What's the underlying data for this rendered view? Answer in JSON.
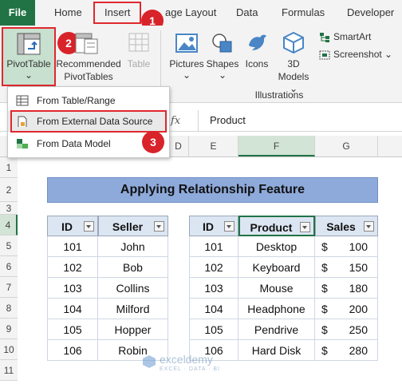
{
  "ribbon_tabs": [
    "File",
    "Home",
    "Insert",
    "age Layout",
    "Data",
    "Formulas",
    "Developer"
  ],
  "pivot": {
    "label": "PivotTable",
    "chevron": "⌄"
  },
  "recommended": {
    "label1": "Recommended",
    "label2": "PivotTables"
  },
  "table_btn": "Table",
  "illustrations": {
    "pictures": "Pictures",
    "shapes": "Shapes",
    "icons": "Icons",
    "models_3d_1": "3D",
    "models_3d_2": "Models",
    "smartart": "SmartArt",
    "screenshot": "Screenshot",
    "group_label": "Illustrations"
  },
  "dropdown": {
    "items": [
      "From Table/Range",
      "From External Data Source",
      "From Data Model"
    ]
  },
  "badges": [
    "1",
    "2",
    "3"
  ],
  "formula": {
    "fx": "fx",
    "value": "Product"
  },
  "columns": [
    "D",
    "E",
    "F",
    "G"
  ],
  "rows": [
    "1",
    "2",
    "3",
    "4",
    "5",
    "6",
    "7",
    "8",
    "9",
    "10",
    "11"
  ],
  "title": "Applying Relationship Feature",
  "table1": {
    "headers": [
      "ID",
      "Seller"
    ],
    "rows": [
      [
        "101",
        "John"
      ],
      [
        "102",
        "Bob"
      ],
      [
        "103",
        "Collins"
      ],
      [
        "104",
        "Milford"
      ],
      [
        "105",
        "Hopper"
      ],
      [
        "106",
        "Robin"
      ]
    ]
  },
  "table2": {
    "headers": [
      "ID",
      "Product",
      "Sales"
    ],
    "rows": [
      [
        "101",
        "Desktop",
        "$",
        "100"
      ],
      [
        "102",
        "Keyboard",
        "$",
        "150"
      ],
      [
        "103",
        "Mouse",
        "$",
        "180"
      ],
      [
        "104",
        "Headphone",
        "$",
        "200"
      ],
      [
        "105",
        "Pendrive",
        "$",
        "250"
      ],
      [
        "106",
        "Hard Disk",
        "$",
        "280"
      ]
    ]
  },
  "watermark": {
    "name": "exceldemy",
    "tagline": "EXCEL · DATA · BI"
  },
  "colors": {
    "excel_green": "#217346",
    "header_fill": "#dce6f2",
    "title_fill": "#8eaadb",
    "callout_red": "#d8232a"
  }
}
